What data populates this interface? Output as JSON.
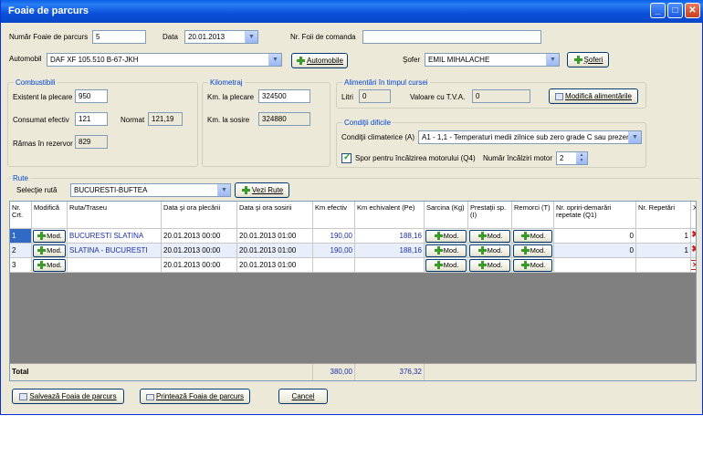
{
  "window": {
    "title": "Foaie de parcurs"
  },
  "header": {
    "nr_foaie_label": "Număr Foaie de parcurs",
    "nr_foaie_value": "5",
    "data_label": "Data",
    "data_value": "20.01.2013",
    "nr_comanda_label": "Nr. Foii de comanda",
    "nr_comanda_value": "",
    "automobil_label": "Automobil",
    "automobil_value": "DAF XF 105.510 B-67-JKH",
    "automobile_button": "Automobile",
    "sofer_label": "Şofer",
    "sofer_value": "EMIL MIHALACHE",
    "soferi_button": "Şoferi"
  },
  "combustibil": {
    "title": "Combustibili",
    "existent_label": "Existent la plecare",
    "existent_value": "950",
    "consumat_label": "Consumat efectiv",
    "consumat_value": "121",
    "normat_label": "Normat",
    "normat_value": "121,19",
    "ramas_label": "Rămas în rezervor",
    "ramas_value": "829"
  },
  "kilometraj": {
    "title": "Kilometraj",
    "plecare_label": "Km. la plecare",
    "plecare_value": "324500",
    "sosire_label": "Km. la sosire",
    "sosire_value": "324880"
  },
  "alimentari": {
    "title": "Alimentări în timpul cursei",
    "litri_label": "Litri",
    "litri_value": "0",
    "valoare_label": "Valoare cu T.V.A.",
    "valoare_value": "0",
    "modifica_button": "Modifică alimentările"
  },
  "conditii": {
    "title": "Condiţii dificile",
    "climatice_label": "Condiţii climaterice (A)",
    "climatice_value": "A1 - 1,1 - Temperaturi medii zilnice sub zero grade C sau prezen",
    "spor_label": "Spor pentru încălzirea motorului (Q4)",
    "spor_checked": true,
    "numar_label": "Număr încălziri motor",
    "numar_value": "2"
  },
  "rute": {
    "title": "Rute",
    "selectie_label": "Selecţie rută",
    "selectie_value": "BUCURESTI-BUFTEA",
    "vezi_button": "Vezi Rute"
  },
  "grid": {
    "columns": [
      "Nr. Crt.",
      "Modifică",
      "Ruta/Traseu",
      "Data şi ora plecării",
      "Data şi ora sosirii",
      "Km efectiv",
      "Km echivalent (Pe)",
      "Sarcina (Kg)",
      "Prestaţii sp. (I)",
      "Remorci (T)",
      "Nr. opriri-demarări repetate (Q1)",
      "Nr. Repetări",
      "X"
    ],
    "mod_label": "Mod.",
    "rows": [
      {
        "nr": "1",
        "ruta": "BUCURESTI SLATINA",
        "plecare": "20.01.2013 00:00",
        "sosire": "20.01.2013 01:00",
        "km_efectiv": "190,00",
        "km_echiv": "188,16",
        "opriri": "0",
        "repetari": "1"
      },
      {
        "nr": "2",
        "ruta": "SLATINA - BUCURESTI",
        "plecare": "20.01.2013 00:00",
        "sosire": "20.01.2013 01:00",
        "km_efectiv": "190,00",
        "km_echiv": "188,16",
        "opriri": "0",
        "repetari": "1"
      },
      {
        "nr": "3",
        "ruta": "",
        "plecare": "20.01.2013 00:00",
        "sosire": "20.01.2013 01:00",
        "km_efectiv": "",
        "km_echiv": "",
        "opriri": "",
        "repetari": ""
      }
    ],
    "total_label": "Total",
    "total_km_efectiv": "380,00",
    "total_km_echiv": "376,32"
  },
  "footer": {
    "salveaza_button": "Salvează Foaia de parcurs",
    "printeaza_button": "Printează Foaia de parcurs",
    "cancel_button": "Cancel"
  },
  "colors": {
    "title_bar": "#0a5fe8",
    "group_title": "#0046d5",
    "selection": "#316ac5",
    "delete": "#d02020"
  }
}
